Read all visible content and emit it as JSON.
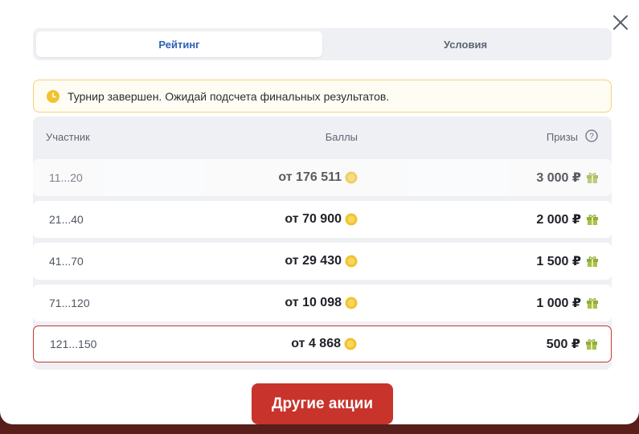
{
  "tabs": [
    {
      "label": "Рейтинг",
      "active": true
    },
    {
      "label": "Условия",
      "active": false
    }
  ],
  "notice": {
    "icon": "clock-icon",
    "text": "Турнир завершен. Ожидай подсчета финальных результатов."
  },
  "table": {
    "headers": {
      "participant": "Участник",
      "points": "Баллы",
      "prizes": "Призы"
    },
    "rows": [
      {
        "rank": "11...20",
        "points": "от 176 511",
        "prize": "3 000 ₽"
      },
      {
        "rank": "21...40",
        "points": "от 70 900",
        "prize": "2 000 ₽"
      },
      {
        "rank": "41...70",
        "points": "от 29 430",
        "prize": "1 500 ₽"
      },
      {
        "rank": "71...120",
        "points": "от 10 098",
        "prize": "1 000 ₽"
      },
      {
        "rank": "121...150",
        "points": "от 4 868",
        "prize": "500 ₽"
      }
    ]
  },
  "promo_button": {
    "label": "Другие акции"
  },
  "colors": {
    "accent": "#c8332b",
    "tab_active": "#2d5fb5",
    "coin": "#f2c230",
    "gift": "#8fae3a",
    "notice_border": "#f1d27a"
  }
}
